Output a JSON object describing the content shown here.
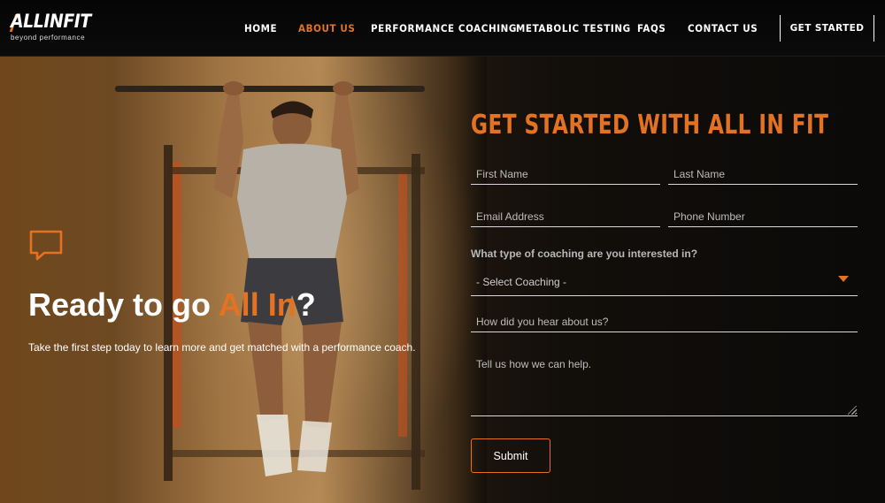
{
  "header": {
    "logo_text": "ALLINFIT",
    "logo_tagline": "beyond performance",
    "nav": {
      "home": "HOME",
      "about": "ABOUT US",
      "performance": "PERFORMANCE COACHING",
      "metabolic": "METABOLIC TESTING",
      "faqs": "FAQS",
      "contact": "CONTACT US"
    },
    "active_nav": "ABOUT US",
    "cta": "GET STARTED"
  },
  "hero": {
    "icon": "chat-bubble-icon",
    "title_before": "Ready to go ",
    "title_highlight": "All In",
    "title_after": "?",
    "text": "Take the first step today to learn more and get matched with a performance coach."
  },
  "form": {
    "title": "GET STARTED WITH ALL IN FIT",
    "first_name_placeholder": "First Name",
    "last_name_placeholder": "Last Name",
    "email_placeholder": "Email Address",
    "phone_placeholder": "Phone Number",
    "coaching_question": "What type of coaching are you interested in?",
    "coaching_selected": "- Select Coaching -",
    "hear_placeholder": "How did you hear about us?",
    "help_placeholder": "Tell us how we can help.",
    "submit_label": "Submit"
  },
  "colors": {
    "accent": "#e37222",
    "background": "#0d0b09",
    "text": "#ffffff"
  }
}
